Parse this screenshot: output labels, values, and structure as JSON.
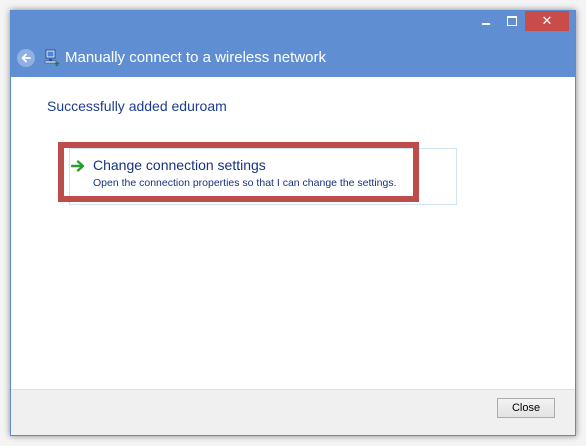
{
  "window": {
    "title": "Manually connect to a wireless network",
    "minimize_label": "",
    "maximize_label": "",
    "close_glyph": "✕"
  },
  "content": {
    "heading": "Successfully added eduroam",
    "option": {
      "title": "Change connection settings",
      "description": "Open the connection properties so that I can change the settings."
    }
  },
  "footer": {
    "close_label": "Close"
  },
  "icons": {
    "back": "back-arrow-icon",
    "network": "wireless-network-icon",
    "option_arrow": "green-arrow-icon"
  },
  "colors": {
    "titlebar": "#5f8ed3",
    "close_button": "#c74c4a",
    "highlight": "#bd4c4a",
    "link_text": "#16337e"
  }
}
